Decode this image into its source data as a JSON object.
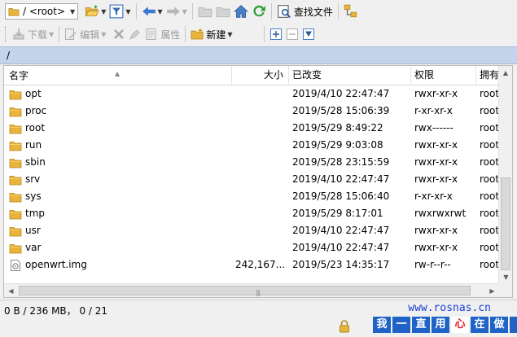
{
  "toolbar1": {
    "path_combo": "/ <root>",
    "find_files_label": "查找文件"
  },
  "toolbar2": {
    "download_label": "下载",
    "edit_label": "编辑",
    "properties_label": "属性",
    "new_label": "新建"
  },
  "path_bar": {
    "path": "/"
  },
  "file_list": {
    "columns": [
      "名字",
      "大小",
      "已改变",
      "权限",
      "拥有"
    ],
    "rows": [
      {
        "name": "opt",
        "size": "",
        "changed": "2019/4/10 22:47:47",
        "perms": "rwxr-xr-x",
        "owner": "root",
        "type": "folder"
      },
      {
        "name": "proc",
        "size": "",
        "changed": "2019/5/28 15:06:39",
        "perms": "r-xr-xr-x",
        "owner": "root",
        "type": "folder"
      },
      {
        "name": "root",
        "size": "",
        "changed": "2019/5/29 8:49:22",
        "perms": "rwx------",
        "owner": "root",
        "type": "folder"
      },
      {
        "name": "run",
        "size": "",
        "changed": "2019/5/29 9:03:08",
        "perms": "rwxr-xr-x",
        "owner": "root",
        "type": "folder"
      },
      {
        "name": "sbin",
        "size": "",
        "changed": "2019/5/28 23:15:59",
        "perms": "rwxr-xr-x",
        "owner": "root",
        "type": "folder"
      },
      {
        "name": "srv",
        "size": "",
        "changed": "2019/4/10 22:47:47",
        "perms": "rwxr-xr-x",
        "owner": "root",
        "type": "folder"
      },
      {
        "name": "sys",
        "size": "",
        "changed": "2019/5/28 15:06:40",
        "perms": "r-xr-xr-x",
        "owner": "root",
        "type": "folder"
      },
      {
        "name": "tmp",
        "size": "",
        "changed": "2019/5/29 8:17:01",
        "perms": "rwxrwxrwt",
        "owner": "root",
        "type": "folder"
      },
      {
        "name": "usr",
        "size": "",
        "changed": "2019/4/10 22:47:47",
        "perms": "rwxr-xr-x",
        "owner": "root",
        "type": "folder"
      },
      {
        "name": "var",
        "size": "",
        "changed": "2019/4/10 22:47:47",
        "perms": "rwxr-xr-x",
        "owner": "root",
        "type": "folder"
      },
      {
        "name": "openwrt.img",
        "size": "242,167...",
        "changed": "2019/5/23 14:35:17",
        "perms": "rw-r--r--",
        "owner": "root",
        "type": "file"
      }
    ]
  },
  "status": {
    "text": "0 B / 236 MB， 0 / 21",
    "site_url": "www.rosnas.cn",
    "slogan": [
      "我",
      "一",
      "直",
      "用",
      "心",
      "在",
      "做",
      "!"
    ]
  },
  "colors": {
    "path_bar_bg": "#c3d5ea",
    "folder": "#e8b43c",
    "slogan_bg": "#1f63c6",
    "url": "#1a3bd6"
  }
}
